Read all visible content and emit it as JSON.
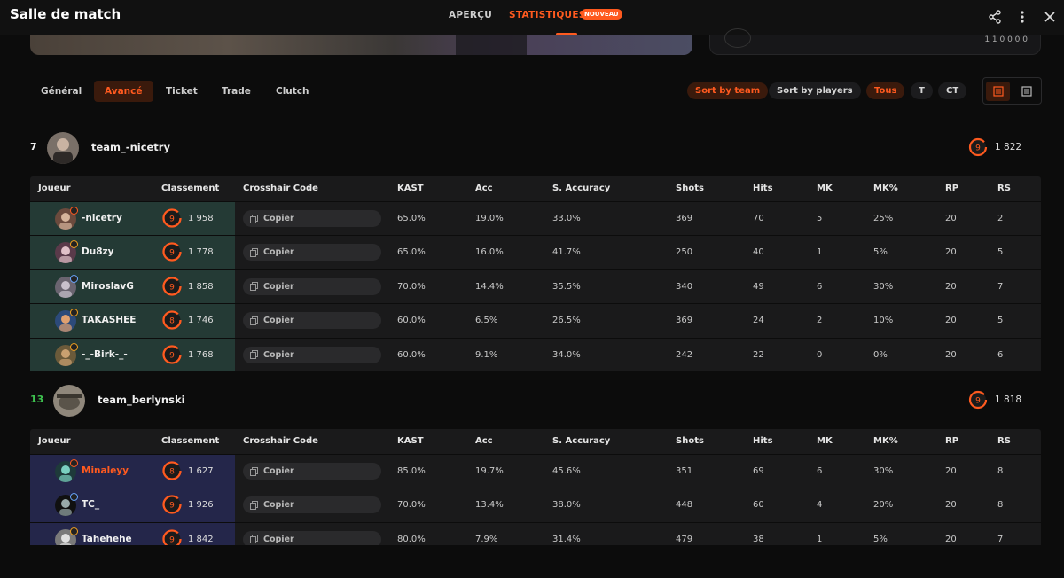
{
  "header": {
    "title": "Salle de match",
    "tabs": [
      {
        "label": "APERÇU"
      },
      {
        "label": "STATISTIQUES",
        "badge": "NOUVEAU"
      }
    ]
  },
  "banner": {
    "right_text": "1 1 0 0 0 0"
  },
  "subtabs": [
    "Général",
    "Avancé",
    "Ticket",
    "Trade",
    "Clutch"
  ],
  "sort": {
    "by_team": "Sort by team",
    "by_players": "Sort by players"
  },
  "sides": [
    "Tous",
    "T",
    "CT"
  ],
  "columns": [
    "Joueur",
    "Classement",
    "Crosshair Code",
    "KAST",
    "Acc",
    "S. Accuracy",
    "Shots",
    "Hits",
    "MK",
    "MK%",
    "RP",
    "RS"
  ],
  "copy_label": "Copier",
  "colors": {
    "accent": "#ff5a1f",
    "win": "#3ec14f",
    "team1_row": "#243a35",
    "team2_row": "#24264a"
  },
  "teams": [
    {
      "score": "7",
      "name": "team_-nicetry",
      "elo": "1 822",
      "level": "9",
      "players": [
        {
          "name": "-nicetry",
          "level": "9",
          "elo": "1 958",
          "kast": "65.0%",
          "acc": "19.0%",
          "sacc": "33.0%",
          "shots": "369",
          "hits": "70",
          "mk": "5",
          "mkp": "25%",
          "rp": "20",
          "rs": "2"
        },
        {
          "name": "Du8zy",
          "level": "9",
          "elo": "1 778",
          "kast": "65.0%",
          "acc": "16.0%",
          "sacc": "41.7%",
          "shots": "250",
          "hits": "40",
          "mk": "1",
          "mkp": "5%",
          "rp": "20",
          "rs": "5"
        },
        {
          "name": "MiroslavG",
          "level": "9",
          "elo": "1 858",
          "kast": "70.0%",
          "acc": "14.4%",
          "sacc": "35.5%",
          "shots": "340",
          "hits": "49",
          "mk": "6",
          "mkp": "30%",
          "rp": "20",
          "rs": "7"
        },
        {
          "name": "TAKASHEE",
          "level": "8",
          "elo": "1 746",
          "kast": "60.0%",
          "acc": "6.5%",
          "sacc": "26.5%",
          "shots": "369",
          "hits": "24",
          "mk": "2",
          "mkp": "10%",
          "rp": "20",
          "rs": "5"
        },
        {
          "name": "-_-Birk-_-",
          "level": "9",
          "elo": "1 768",
          "kast": "60.0%",
          "acc": "9.1%",
          "sacc": "34.0%",
          "shots": "242",
          "hits": "22",
          "mk": "0",
          "mkp": "0%",
          "rp": "20",
          "rs": "6"
        }
      ]
    },
    {
      "score": "13",
      "name": "team_berlynski",
      "elo": "1 818",
      "level": "9",
      "players": [
        {
          "name": "Minaleyy",
          "level": "8",
          "elo": "1 627",
          "kast": "85.0%",
          "acc": "19.7%",
          "sacc": "45.6%",
          "shots": "351",
          "hits": "69",
          "mk": "6",
          "mkp": "30%",
          "rp": "20",
          "rs": "8"
        },
        {
          "name": "TC_",
          "level": "9",
          "elo": "1 926",
          "kast": "70.0%",
          "acc": "13.4%",
          "sacc": "38.0%",
          "shots": "448",
          "hits": "60",
          "mk": "4",
          "mkp": "20%",
          "rp": "20",
          "rs": "8"
        },
        {
          "name": "Tahehehe",
          "level": "9",
          "elo": "1 842",
          "kast": "80.0%",
          "acc": "7.9%",
          "sacc": "31.4%",
          "shots": "479",
          "hits": "38",
          "mk": "1",
          "mkp": "5%",
          "rp": "20",
          "rs": "7"
        }
      ]
    }
  ]
}
